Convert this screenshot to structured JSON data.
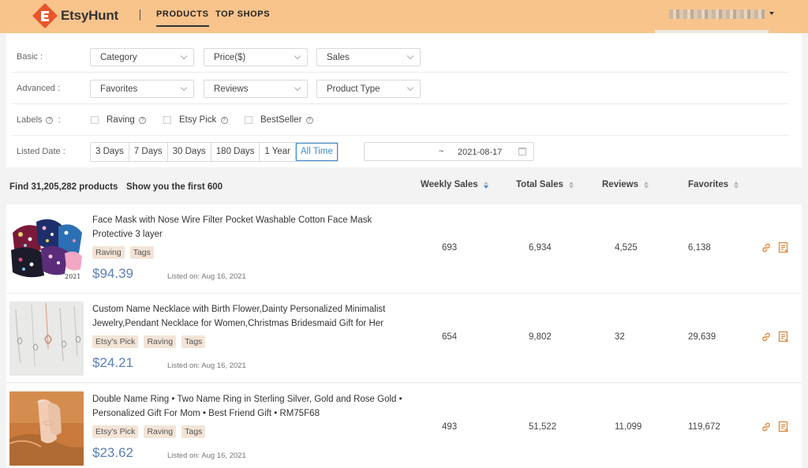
{
  "brand": {
    "name_part1": "Etsy",
    "name_part2": "Hunt"
  },
  "nav": [
    {
      "label": "PRODUCTS",
      "active": true
    },
    {
      "label": "TOP SHOPS",
      "active": false
    }
  ],
  "filters": {
    "basic": {
      "label": "Basic :",
      "selects": [
        "Category",
        "Price($)",
        "Sales"
      ]
    },
    "advanced": {
      "label": "Advanced :",
      "selects": [
        "Favorites",
        "Reviews",
        "Product Type"
      ]
    },
    "labels": {
      "label": "Labels",
      "suffix": ":",
      "options": [
        "Raving",
        "Etsy Pick",
        "BestSeller"
      ]
    },
    "listed_date": {
      "label": "Listed Date :",
      "ranges": [
        "3 Days",
        "7 Days",
        "30 Days",
        "180 Days",
        "1 Year",
        "All Time"
      ],
      "active": "All Time",
      "from": "",
      "separator": "~",
      "to": "2021-08-17"
    }
  },
  "results": {
    "found_text": "Find 31,205,282 products",
    "showing_text": "Show you the first 600",
    "columns": [
      "Weekly Sales",
      "Total Sales",
      "Reviews",
      "Favorites"
    ]
  },
  "products": [
    {
      "title": "Face Mask with Nose Wire Filter Pocket Washable Cotton Face Mask Protective 3 layer",
      "tags": [
        "Raving",
        "Tags"
      ],
      "price": "$94.39",
      "listed": "Listed on: Aug 16, 2021",
      "weekly_sales": "693",
      "total_sales": "6,934",
      "reviews": "4,525",
      "favorites": "6,138",
      "thumb_caption": "2021"
    },
    {
      "title": "Custom Name Necklace with Birth Flower,Dainty Personalized Minimalist Jewelry,Pendant Necklace for Women,Christmas Bridesmaid Gift for Her",
      "tags": [
        "Etsy's Pick",
        "Raving",
        "Tags"
      ],
      "price": "$24.21",
      "listed": "Listed on: Aug 16, 2021",
      "weekly_sales": "654",
      "total_sales": "9,802",
      "reviews": "32",
      "favorites": "29,639"
    },
    {
      "title": "Double Name Ring • Two Name Ring in Sterling Silver, Gold and Rose Gold • Personalized Gift For Mom • Best Friend Gift • RM75F68",
      "tags": [
        "Etsy's Pick",
        "Raving",
        "Tags"
      ],
      "price": "$23.62",
      "listed": "Listed on: Aug 16, 2021",
      "weekly_sales": "493",
      "total_sales": "51,522",
      "reviews": "11,099",
      "favorites": "119,672"
    }
  ],
  "colors": {
    "header_bg": "#f8c48c",
    "price": "#5b7fb8",
    "accent": "#3c8ccf",
    "action_icons": "#e0873c"
  }
}
